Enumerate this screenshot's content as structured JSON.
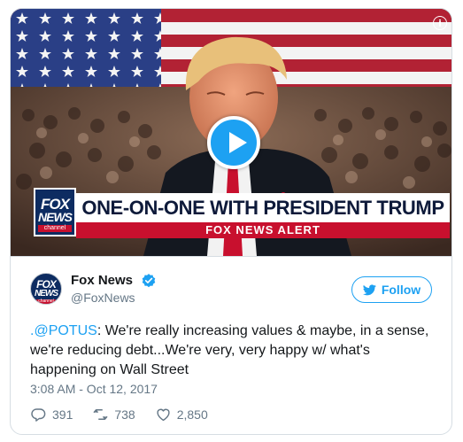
{
  "media": {
    "info_glyph": "i",
    "lower_third": {
      "logo_line1": "FOX",
      "logo_line2": "NEWS",
      "logo_line3": "channel",
      "headline": "ONE-ON-ONE WITH PRESIDENT TRUMP",
      "alert": "FOX NEWS ALERT"
    }
  },
  "author": {
    "name": "Fox News",
    "handle": "@FoxNews",
    "avatar_line1": "FOX",
    "avatar_line2": "NEWS",
    "avatar_line3": "channel"
  },
  "follow_label": "Follow",
  "tweet": {
    "mention": ".@POTUS",
    "text": ": We're really increasing values & maybe, in a sense, we're reducing debt...We're very, very happy w/ what's happening on Wall Street",
    "timestamp": "3:08 AM - Oct 12, 2017"
  },
  "stats": {
    "replies": "391",
    "retweets": "738",
    "likes": "2,850"
  },
  "colors": {
    "accent": "#1da1f2",
    "fox_navy": "#0d2c61",
    "fox_red": "#c8102e",
    "secondary_text": "#657786"
  },
  "icons": [
    "info-icon",
    "play-icon",
    "verified-badge-icon",
    "twitter-bird-icon",
    "reply-icon",
    "retweet-icon",
    "like-icon"
  ]
}
